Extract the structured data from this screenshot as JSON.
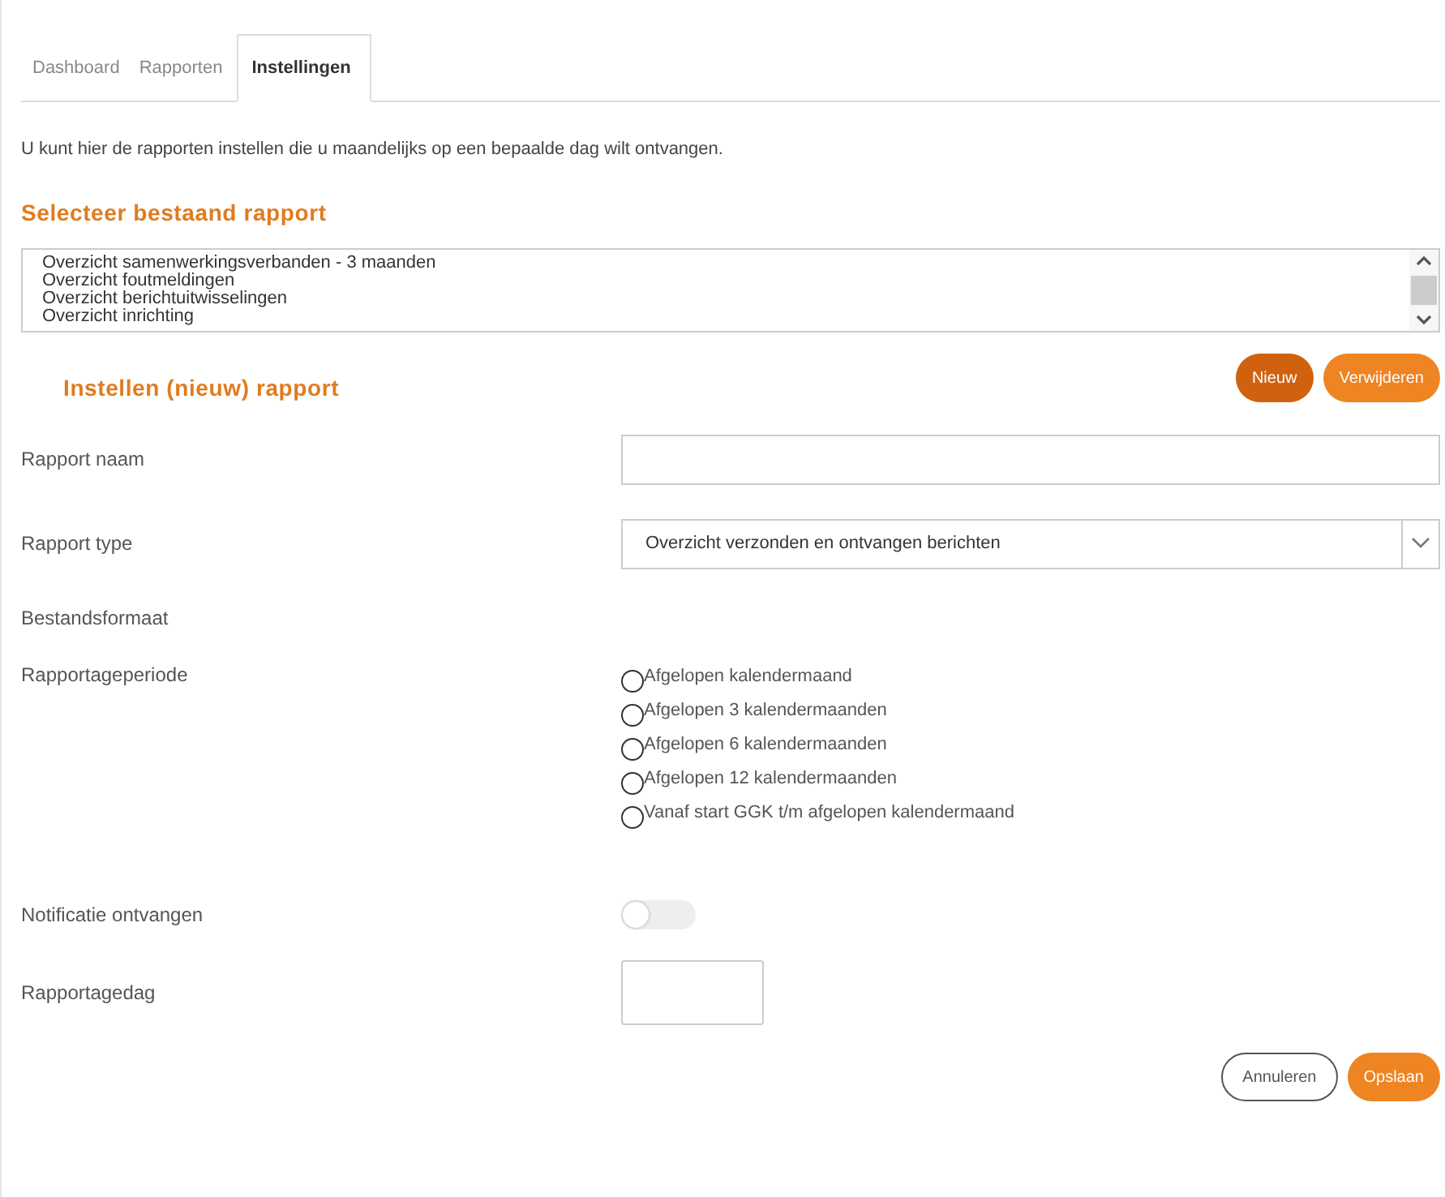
{
  "tabs": [
    {
      "label": "Dashboard",
      "selected": false
    },
    {
      "label": "Rapporten",
      "selected": false
    },
    {
      "label": "Instellingen",
      "selected": true
    }
  ],
  "intro": "U kunt hier de rapporten instellen die u maandelijks op een bepaalde dag wilt ontvangen.",
  "existing": {
    "heading": "Selecteer bestaand rapport",
    "items": [
      "Overzicht samenwerkingsverbanden - 3 maanden",
      "Overzicht foutmeldingen",
      "Overzicht berichtuitwisselingen",
      "Overzicht inrichting"
    ]
  },
  "editor": {
    "heading": "Instellen (nieuw) rapport",
    "buttons": [
      {
        "label": "Nieuw",
        "kind": "dark"
      },
      {
        "label": "Verwijderen",
        "kind": "primary"
      }
    ]
  },
  "form": [
    {
      "kind": "text",
      "label": "Rapport naam"
    },
    {
      "kind": "select",
      "label": "Rapport type",
      "value": "Overzicht verzonden en ontvangen berichten"
    },
    {
      "kind": "none",
      "label": "Bestandsformaat"
    },
    {
      "kind": "radios",
      "label": "Rapportageperiode",
      "options": [
        {
          "label": "Afgelopen kalendermaand",
          "selected": false
        },
        {
          "label": "Afgelopen 3 kalendermaanden",
          "selected": false
        },
        {
          "label": "Afgelopen 6 kalendermaanden",
          "selected": false
        },
        {
          "label": "Afgelopen 12 kalendermaanden",
          "selected": false
        },
        {
          "label": "Vanaf start GGK t/m afgelopen kalendermaand",
          "selected": false
        }
      ]
    },
    {
      "kind": "toggle",
      "label": "Notificatie ontvangen",
      "on": false
    },
    {
      "kind": "short",
      "label": "Rapportagedag"
    }
  ],
  "footer_buttons": [
    {
      "label": "Annuleren",
      "kind": "outline"
    },
    {
      "label": "Opslaan",
      "kind": "primary"
    }
  ]
}
